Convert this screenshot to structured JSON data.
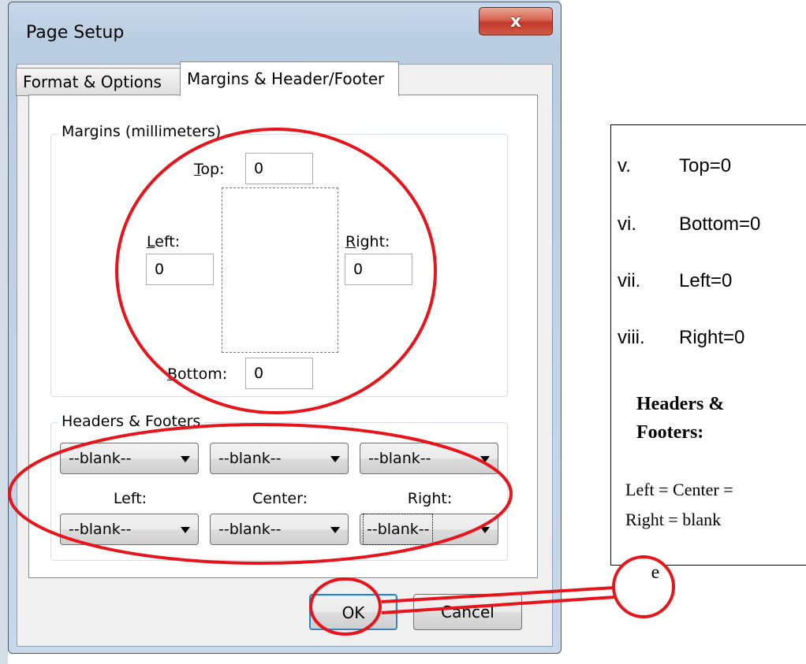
{
  "dialog": {
    "title": "Page Setup",
    "close_glyph": "x",
    "tabs": [
      {
        "label": "Format & Options",
        "active": false
      },
      {
        "label": "Margins & Header/Footer",
        "active": true
      }
    ]
  },
  "margins": {
    "legend": "Margins (millimeters)",
    "top": {
      "accel": "T",
      "rest": "op:",
      "value": "0"
    },
    "left": {
      "accel": "L",
      "rest": "eft:",
      "value": "0"
    },
    "right": {
      "accel": "R",
      "rest": "ight:",
      "value": "0"
    },
    "bottom": {
      "accel": "B",
      "rest": "ottom:",
      "value": "0"
    }
  },
  "headers_footers": {
    "legend": "Headers & Footers",
    "headers": [
      "--blank--",
      "--blank--",
      "--blank--"
    ],
    "labels": [
      "Left:",
      "Center:",
      "Right:"
    ],
    "footers": [
      "--blank--",
      "--blank--",
      "--blank--"
    ]
  },
  "buttons": {
    "ok": "OK",
    "cancel": "Cancel"
  },
  "annotation": {
    "list": [
      {
        "num": "v.",
        "text": "Top=0"
      },
      {
        "num": "vi.",
        "text": "Bottom=0"
      },
      {
        "num": "vii.",
        "text": "Left=0"
      },
      {
        "num": "viii.",
        "text": "Right=0"
      }
    ],
    "hf_title_line1": "Headers &",
    "hf_title_line2": "Footers:",
    "hf_body_line1": "Left = Center =",
    "hf_body_line2": "Right = blank",
    "step_label": "e",
    "highlight_color": "#e8141b"
  }
}
